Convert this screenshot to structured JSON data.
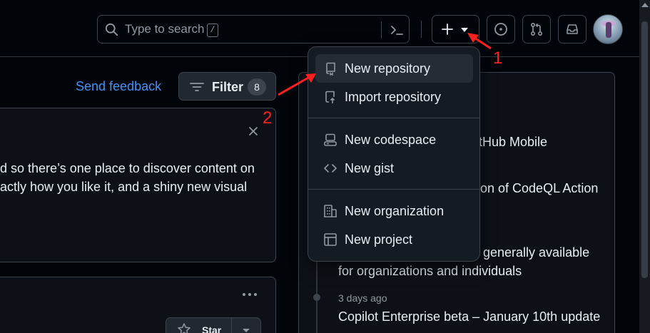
{
  "header": {
    "search_placeholder": "Type to search",
    "search_shortcut": "/"
  },
  "toolbar": {
    "send_feedback": "Send feedback",
    "filter_label": "Filter",
    "filter_count": "8"
  },
  "announcement": {
    "line1": "d so there’s one place to discover content on",
    "line2": "actly how you like it, and a shiny new visual"
  },
  "repo_card": {
    "star_label": "Star"
  },
  "changelog": {
    "items": [
      {
        "text": "tHub Mobile"
      },
      {
        "text": "on of CodeQL Action"
      },
      {
        "text": "generally available"
      },
      {
        "text": "for organizations and individuals"
      },
      {
        "time": "3 days ago",
        "text": "Copilot Enterprise beta – January 10th update"
      }
    ]
  },
  "create_menu": {
    "items": [
      {
        "label": "New repository",
        "icon": "repo-icon"
      },
      {
        "label": "Import repository",
        "icon": "repo-push-icon"
      },
      {
        "label": "New codespace",
        "icon": "codespace-icon"
      },
      {
        "label": "New gist",
        "icon": "code-icon"
      },
      {
        "label": "New organization",
        "icon": "organization-icon"
      },
      {
        "label": "New project",
        "icon": "table-icon"
      }
    ]
  },
  "annotations": {
    "step1": "1",
    "step2": "2"
  },
  "colors": {
    "background": "#010409",
    "accent_link": "#4493f8",
    "annotation": "#ff1f1f",
    "menu_background": "#151b23"
  }
}
